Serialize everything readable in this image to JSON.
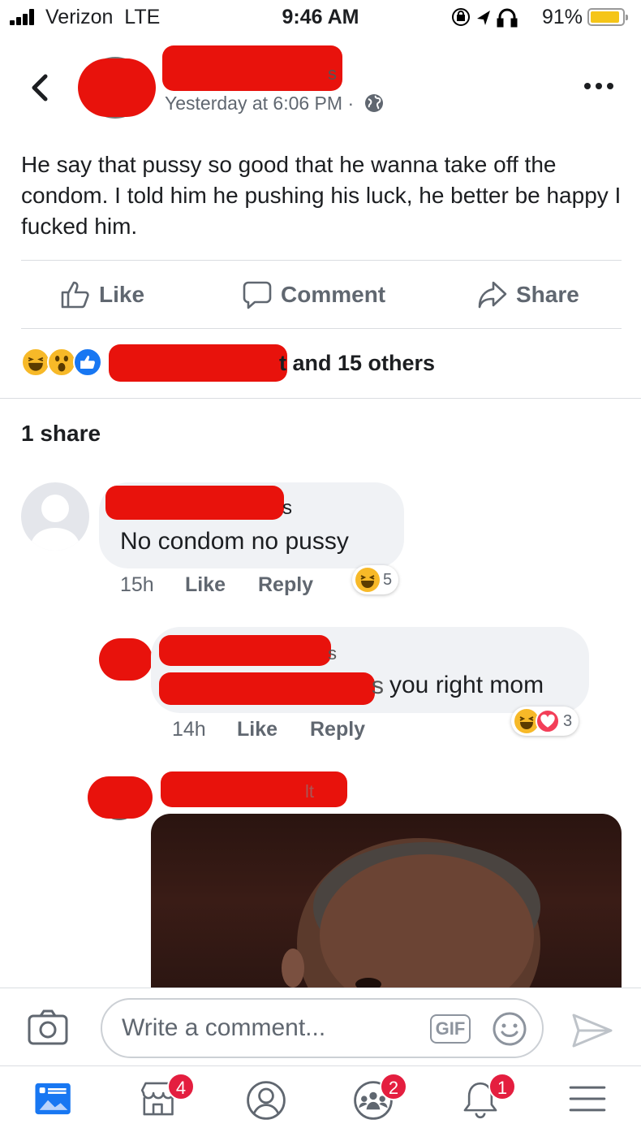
{
  "status_bar": {
    "carrier": "Verizon",
    "network": "LTE",
    "time": "9:46 AM",
    "battery_percent": "91%",
    "battery_level": 0.91
  },
  "post": {
    "author_visible_fragment": "s",
    "timestamp": "Yesterday at 6:06 PM",
    "separator": "·",
    "text": "He say that pussy so good that he wanna take off the condom. I told him he pushing his luck, he better be happy I fucked him."
  },
  "actions": {
    "like": "Like",
    "comment": "Comment",
    "share": "Share"
  },
  "reactions": {
    "summary_fragment": "t and 15 others",
    "icons": [
      "haha-icon",
      "wow-icon",
      "like-icon"
    ]
  },
  "shares_label": "1 share",
  "comments": [
    {
      "author_fragment": "s",
      "text": "No condom no pussy",
      "age": "15h",
      "like": "Like",
      "reply": "Reply",
      "reaction_count": "5"
    },
    {
      "author_fragment": "s",
      "mention_fragment": "s",
      "text": "you right mom",
      "age": "14h",
      "like": "Like",
      "reply": "Reply",
      "reaction_count": "3"
    },
    {
      "author_fragment": "lt"
    }
  ],
  "composer": {
    "placeholder": "Write a comment...",
    "gif_label": "GIF"
  },
  "nav": {
    "marketplace_badge": "4",
    "groups_badge": "2",
    "notifications_badge": "1"
  },
  "colors": {
    "redaction": "#e8120c",
    "facebook_blue": "#1877f2",
    "haha_yellow": "#f7b928",
    "love_red": "#f33e58",
    "badge_red": "#e41e3f"
  }
}
